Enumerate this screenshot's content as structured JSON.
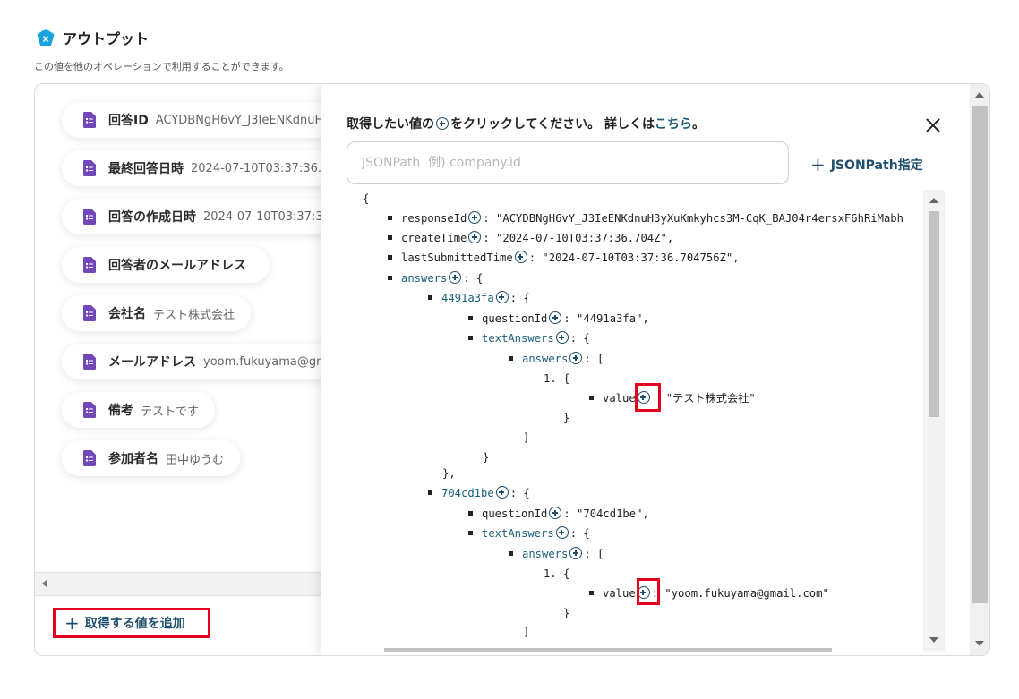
{
  "header": {
    "title": "アウトプット",
    "subtitle": "この値を他のオペレーションで利用することができます。",
    "icon": "variable-x-icon",
    "icon_color": "#19a3dc"
  },
  "fields": [
    {
      "label": "回答ID",
      "value": "ACYDBNgH6vY_J3IeENKdnuH3yXuKmkyhcs3M-CqK_BAJ04r4ersxF6hRiMabh"
    },
    {
      "label": "最終回答日時",
      "value": "2024-07-10T03:37:36.704756Z"
    },
    {
      "label": "回答の作成日時",
      "value": "2024-07-10T03:37:36.704Z"
    },
    {
      "label": "回答者のメールアドレス",
      "value": ""
    },
    {
      "label": "会社名",
      "value": "テスト株式会社"
    },
    {
      "label": "メールアドレス",
      "value": "yoom.fukuyama@gmail.com"
    },
    {
      "label": "備考",
      "value": "テストです"
    },
    {
      "label": "参加者名",
      "value": "田中ゆうむ"
    }
  ],
  "field_icon": "google-forms-icon",
  "field_icon_color": "#7248b9",
  "add_button": {
    "label": "取得する値を追加"
  },
  "panel": {
    "instruction_pre": "取得したい値の",
    "instruction_post": "をクリックしてください。 詳しくは",
    "link_text": "こちら",
    "link_suffix": "。",
    "input_placeholder": "JSONPath  例) company.id",
    "jsonpath_button": "JSONPath指定",
    "accent_color": "#1f4f6e"
  },
  "tree": {
    "open_brace": "{",
    "responseId_key": "responseId",
    "responseId_val": ": \"ACYDBNgH6vY_J3IeENKdnuH3yXuKmkyhcs3M-CqK_BAJ04r4ersxF6hRiMabh",
    "createTime_key": "createTime",
    "createTime_val": ": \"2024-07-10T03:37:36.704Z\",",
    "lastSubmittedTime_key": "lastSubmittedTime",
    "lastSubmittedTime_val": ": \"2024-07-10T03:37:36.704756Z\",",
    "answers_key": "answers",
    "obj_open": ": {",
    "arr_open": ": [",
    "q1_id": "4491a3fa",
    "questionId_key": "questionId",
    "q1_questionId_val": ": \"4491a3fa\",",
    "textAnswers_key": "textAnswers",
    "inner_answers_key": "answers",
    "item_open": "1. {",
    "value_key": "value",
    "q1_value_val": "\"テスト株式会社\"",
    "close_brace": "}",
    "close_bracket": "]",
    "close_brace_comma": "},",
    "q2_id": "704cd1be",
    "q2_questionId_val": ": \"704cd1be\",",
    "q2_value_val": ": \"yoom.fukuyama@gmail.com\""
  },
  "highlight_color": "#e5001f"
}
